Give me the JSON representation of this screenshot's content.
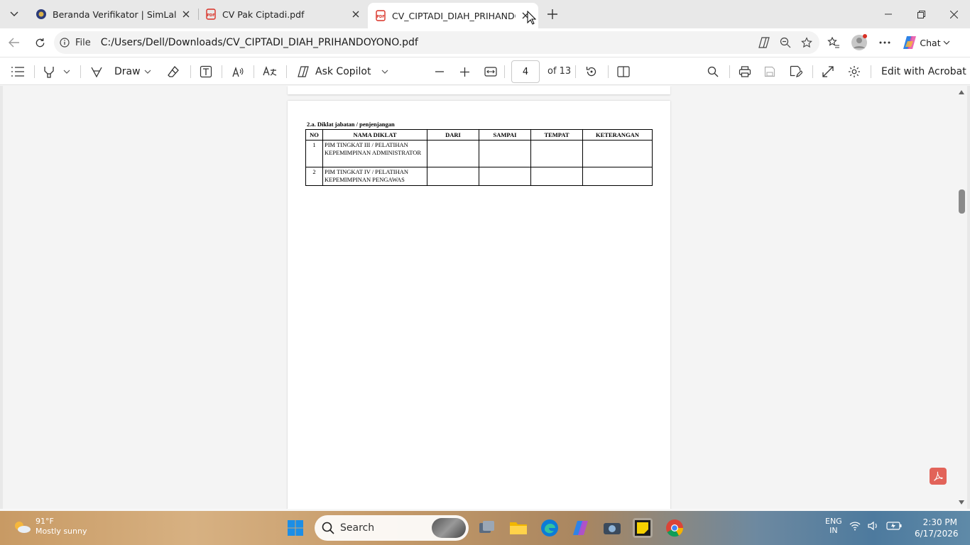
{
  "browser": {
    "tabs": [
      {
        "title": "Beranda Verifikator | SimLala",
        "active": false
      },
      {
        "title": "CV Pak Ciptadi.pdf",
        "active": false
      },
      {
        "title": "CV_CIPTADI_DIAH_PRIHANDOYONO.pdf",
        "active": true
      }
    ],
    "address": {
      "scheme": "File",
      "url": "C:/Users/Dell/Downloads/CV_CIPTADI_DIAH_PRIHANDOYONO.pdf"
    },
    "chat_label": "Chat"
  },
  "pdf_toolbar": {
    "draw_label": "Draw",
    "ask_copilot_label": "Ask Copilot",
    "page_current": "4",
    "page_total": "of 13",
    "edit_label": "Edit with Acrobat"
  },
  "document": {
    "section_title": "2.a. Diklat jabatan / penjenjangan",
    "table": {
      "headers": [
        "NO",
        "NAMA DIKLAT",
        "DARI",
        "SAMPAI",
        "TEMPAT",
        "KETERANGAN"
      ],
      "rows": [
        [
          "1",
          "PIM TINGKAT III / PELATIHAN KEPEMIMPINAN ADMINISTRATOR",
          "",
          "",
          "",
          ""
        ],
        [
          "2",
          "PIM TINGKAT IV / PELATIHAN KEPEMIMPINAN PENGAWAS",
          "",
          "",
          "",
          ""
        ]
      ]
    }
  },
  "taskbar": {
    "weather_temp": "91°F",
    "weather_desc": "Mostly sunny",
    "search_placeholder": "Search",
    "lang_1": "ENG",
    "lang_2": "IN",
    "time": "2:30 PM",
    "date": "6/17/2026"
  },
  "colors": {
    "pdf_red": "#d93025",
    "edge_blue": "#0c7bd8",
    "windows_blue": "#1c8ee6"
  }
}
